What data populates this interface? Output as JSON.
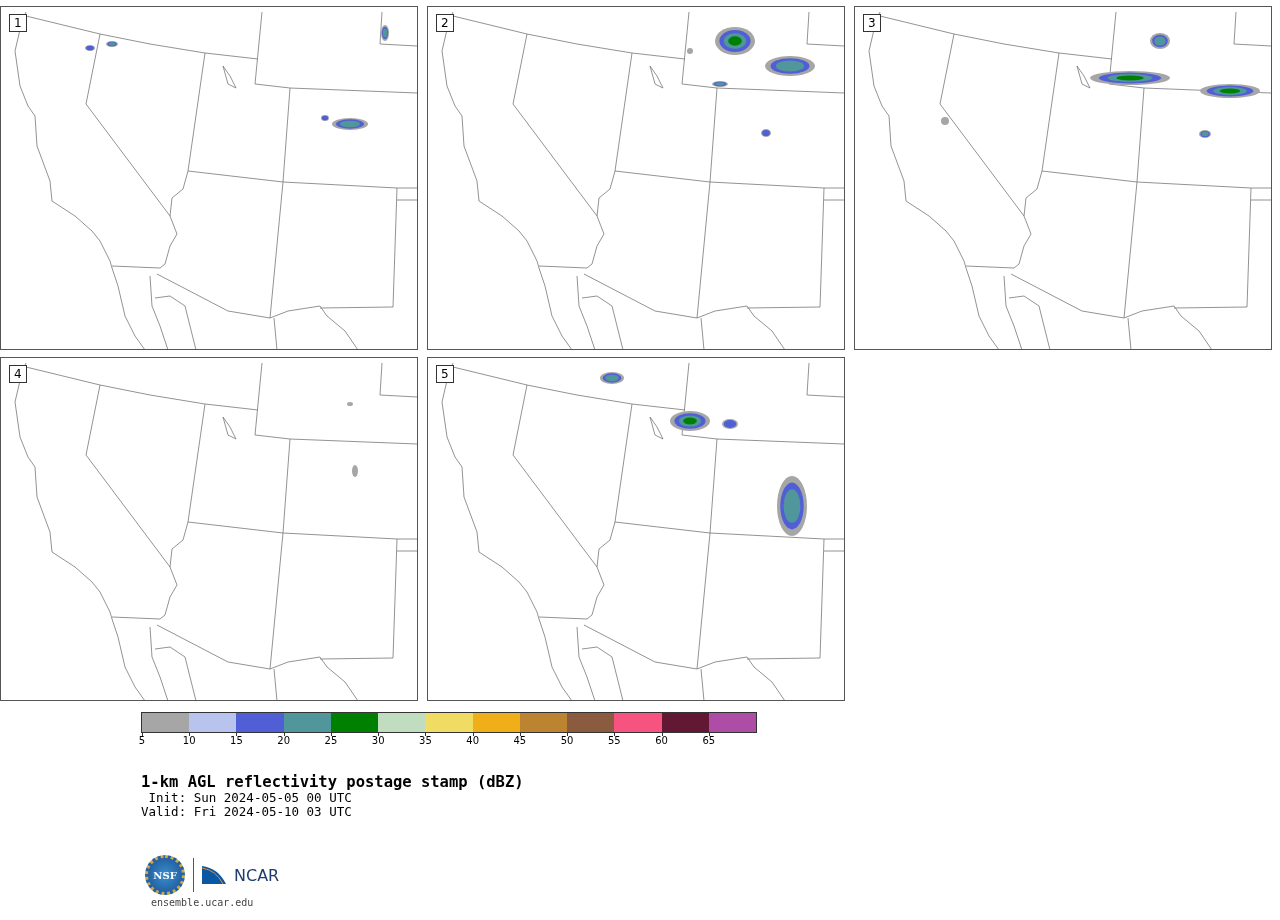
{
  "panels": [
    {
      "label": "1"
    },
    {
      "label": "2"
    },
    {
      "label": "3"
    },
    {
      "label": "4"
    },
    {
      "label": "5"
    }
  ],
  "colorbar": {
    "bins": [
      {
        "label": "5",
        "color": "#a6a6a6"
      },
      {
        "label": "10",
        "color": "#b8c3ee"
      },
      {
        "label": "15",
        "color": "#505fd6"
      },
      {
        "label": "20",
        "color": "#50969a"
      },
      {
        "label": "25",
        "color": "#008000"
      },
      {
        "label": "30",
        "color": "#c0ddbf"
      },
      {
        "label": "35",
        "color": "#f0dc62"
      },
      {
        "label": "40",
        "color": "#f0ae19"
      },
      {
        "label": "45",
        "color": "#bc8431"
      },
      {
        "label": "50",
        "color": "#8b5b40"
      },
      {
        "label": "55",
        "color": "#f65380"
      },
      {
        "label": "60",
        "color": "#621733"
      },
      {
        "label": "65",
        "color": "#ae4da5"
      }
    ]
  },
  "title": "1-km AGL reflectivity postage stamp (dBZ)",
  "init": " Init: Sun 2024-05-05 00 UTC",
  "valid": "Valid: Fri 2024-05-10 03 UTC",
  "logo": {
    "nsf": "NSF",
    "ncar": "NCAR"
  },
  "url": "ensemble.ucar.edu"
}
